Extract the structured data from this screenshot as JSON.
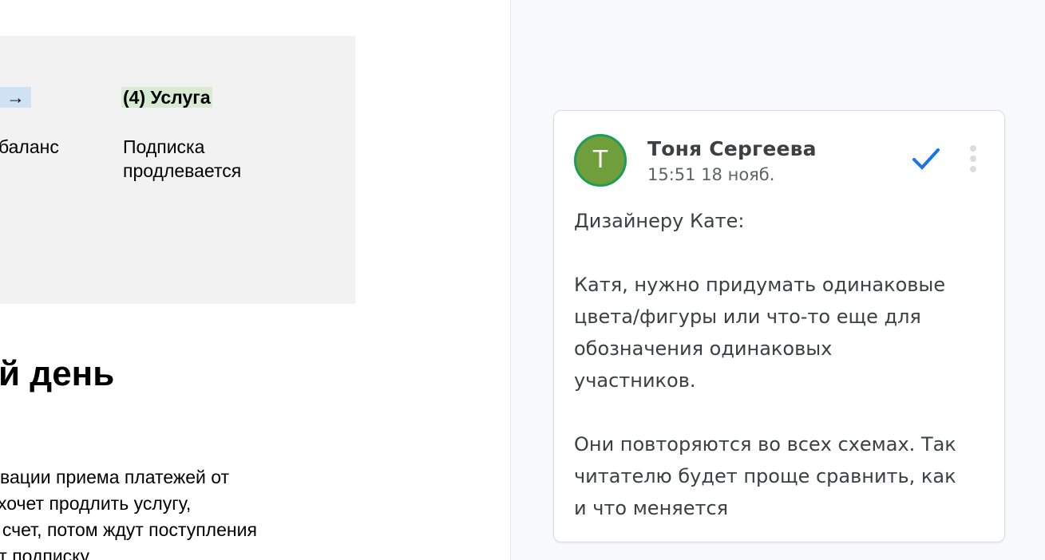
{
  "document": {
    "table": {
      "col1_head": "→",
      "col1_body": "баланс",
      "col2_head": "(4) Услуга",
      "col2_body_lines": [
        "Подписка",
        "продлевается"
      ]
    },
    "section_title": "й день",
    "paragraph_lines": [
      "вации приема платежей от",
      "хочет продлить услугу,",
      "т счет, потом ждут поступления",
      "от подписку"
    ]
  },
  "comment": {
    "avatar_letter": "Т",
    "author": "Тоня Сергеева",
    "timestamp": "15:51 18 нояб.",
    "resolve_icon": "checkmark-icon",
    "more_icon": "more-vertical-icon",
    "accent_color": "#1a73e8",
    "avatar_color": "#6f9e3a",
    "body_lines": [
      "Дизайнеру Кате:",
      "",
      "Катя, нужно придумать одинаковые",
      "цвета/фигуры или что-то еще для",
      "обозначения одинаковых",
      "участников.",
      "",
      "Они повторяются во всех схемах. Так",
      "читателю будет проще сравнить, как",
      "и что меняется"
    ]
  }
}
